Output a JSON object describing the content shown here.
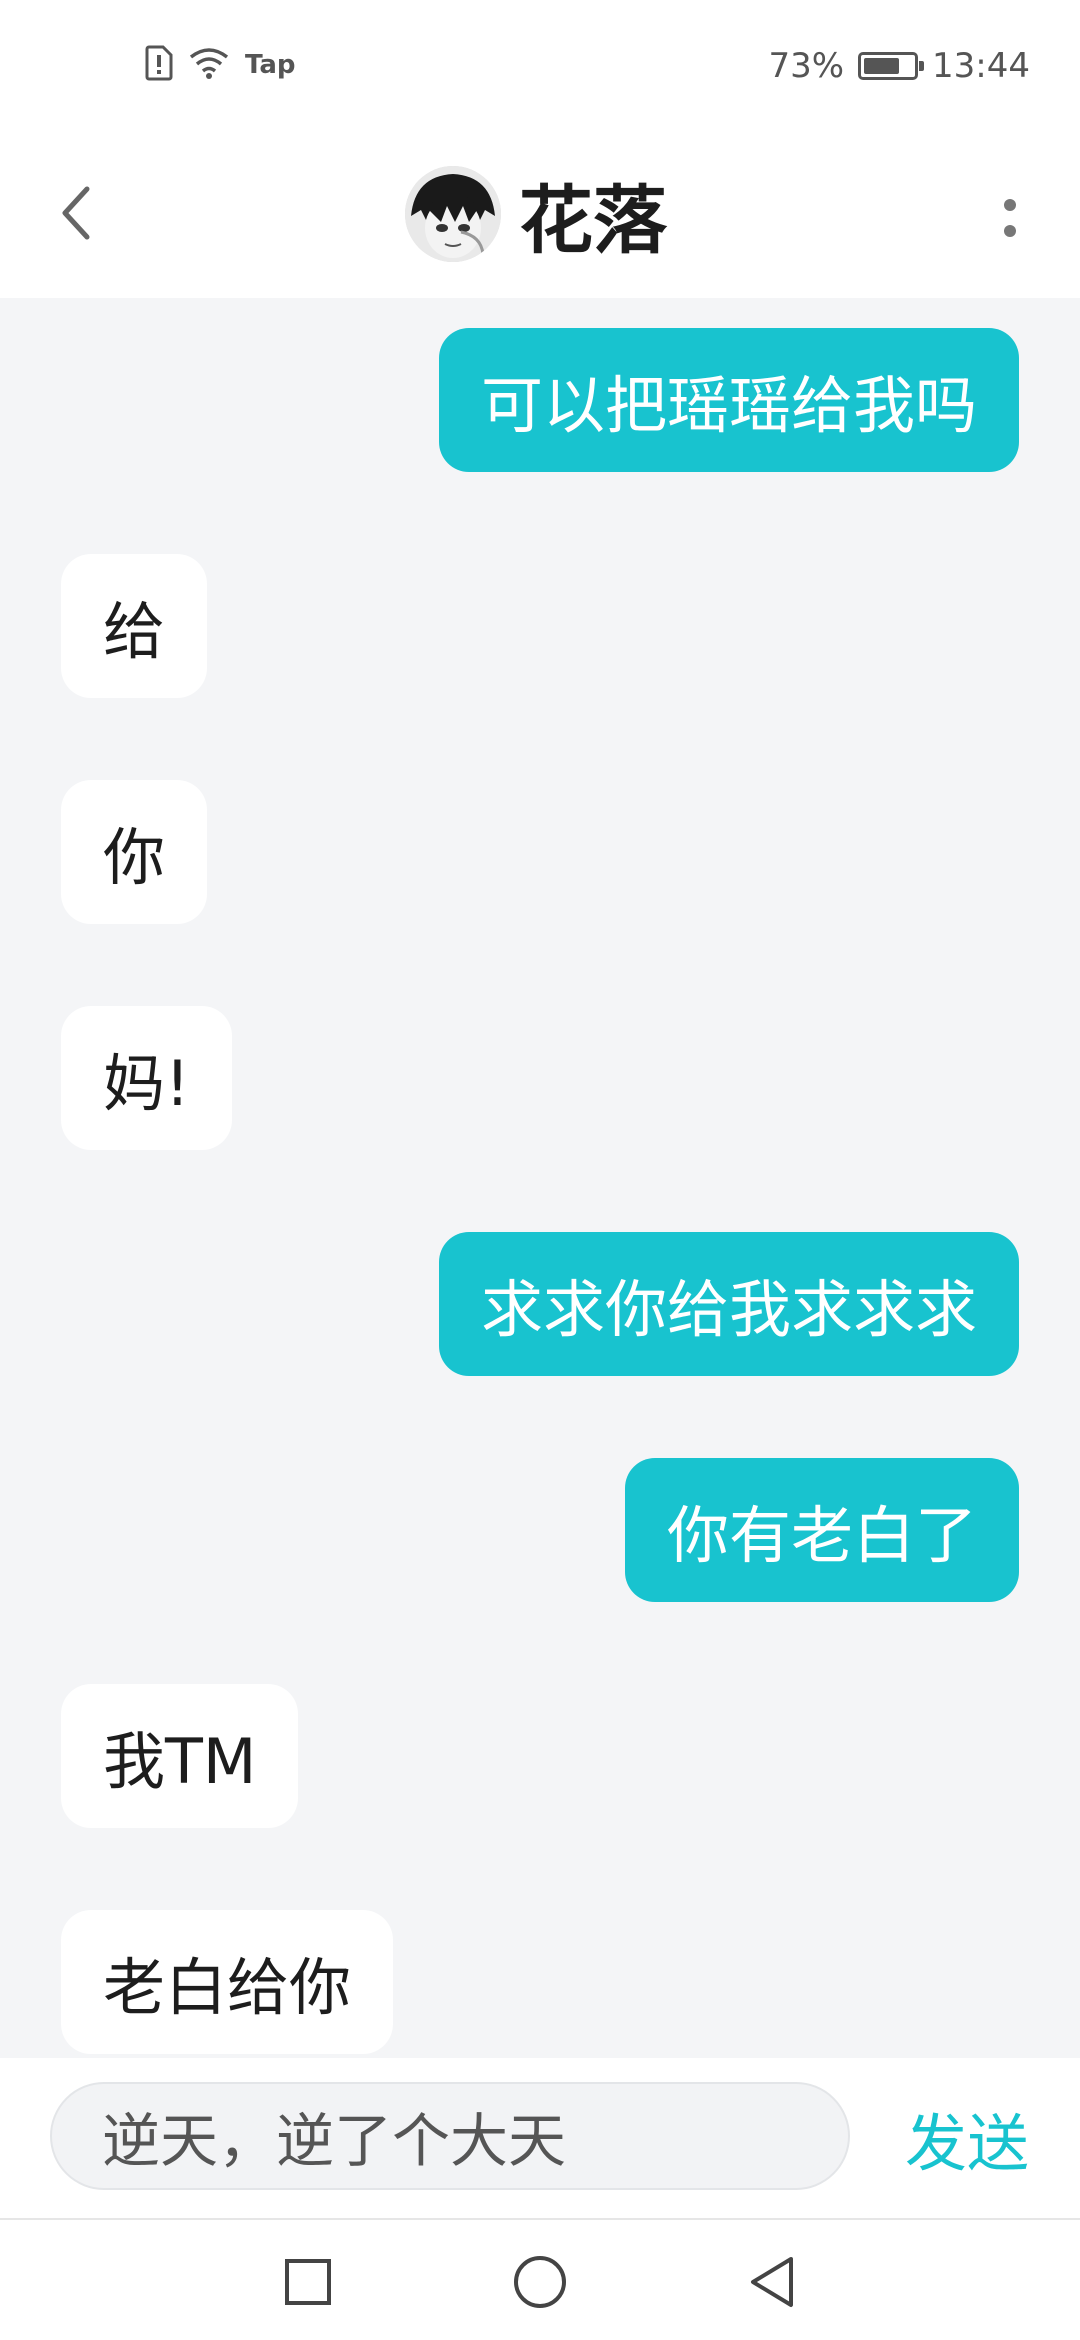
{
  "status_bar": {
    "icons": [
      "sim-alert-icon",
      "wifi-icon",
      "tap-app-icon"
    ],
    "tap_label": "Tap",
    "battery_percent": "73%",
    "battery_level": 0.73,
    "time": "13:44"
  },
  "header": {
    "back_icon": "chevron-left-icon",
    "contact_name": "花落",
    "avatar_icon": "avatar-image",
    "more_icon": "more-vertical-icon"
  },
  "messages": [
    {
      "direction": "out",
      "text": "可以把瑶瑶给我吗"
    },
    {
      "direction": "in",
      "text": "给"
    },
    {
      "direction": "in",
      "text": "你"
    },
    {
      "direction": "in",
      "text": "妈!"
    },
    {
      "direction": "out",
      "text": "求求你给我求求求"
    },
    {
      "direction": "out",
      "text": "你有老白了"
    },
    {
      "direction": "in",
      "text": "我TM"
    },
    {
      "direction": "in",
      "text": "老白给你"
    }
  ],
  "input_bar": {
    "value": "逆天，逆了个大天",
    "send_label": "发送"
  },
  "nav_bar": {
    "icons": [
      "recent-apps-icon",
      "home-icon",
      "back-triangle-icon"
    ]
  },
  "colors": {
    "accent": "#18c3cf",
    "chat_background": "#f4f5f7",
    "incoming_bubble": "#ffffff",
    "text_primary": "#1d1d1d"
  }
}
